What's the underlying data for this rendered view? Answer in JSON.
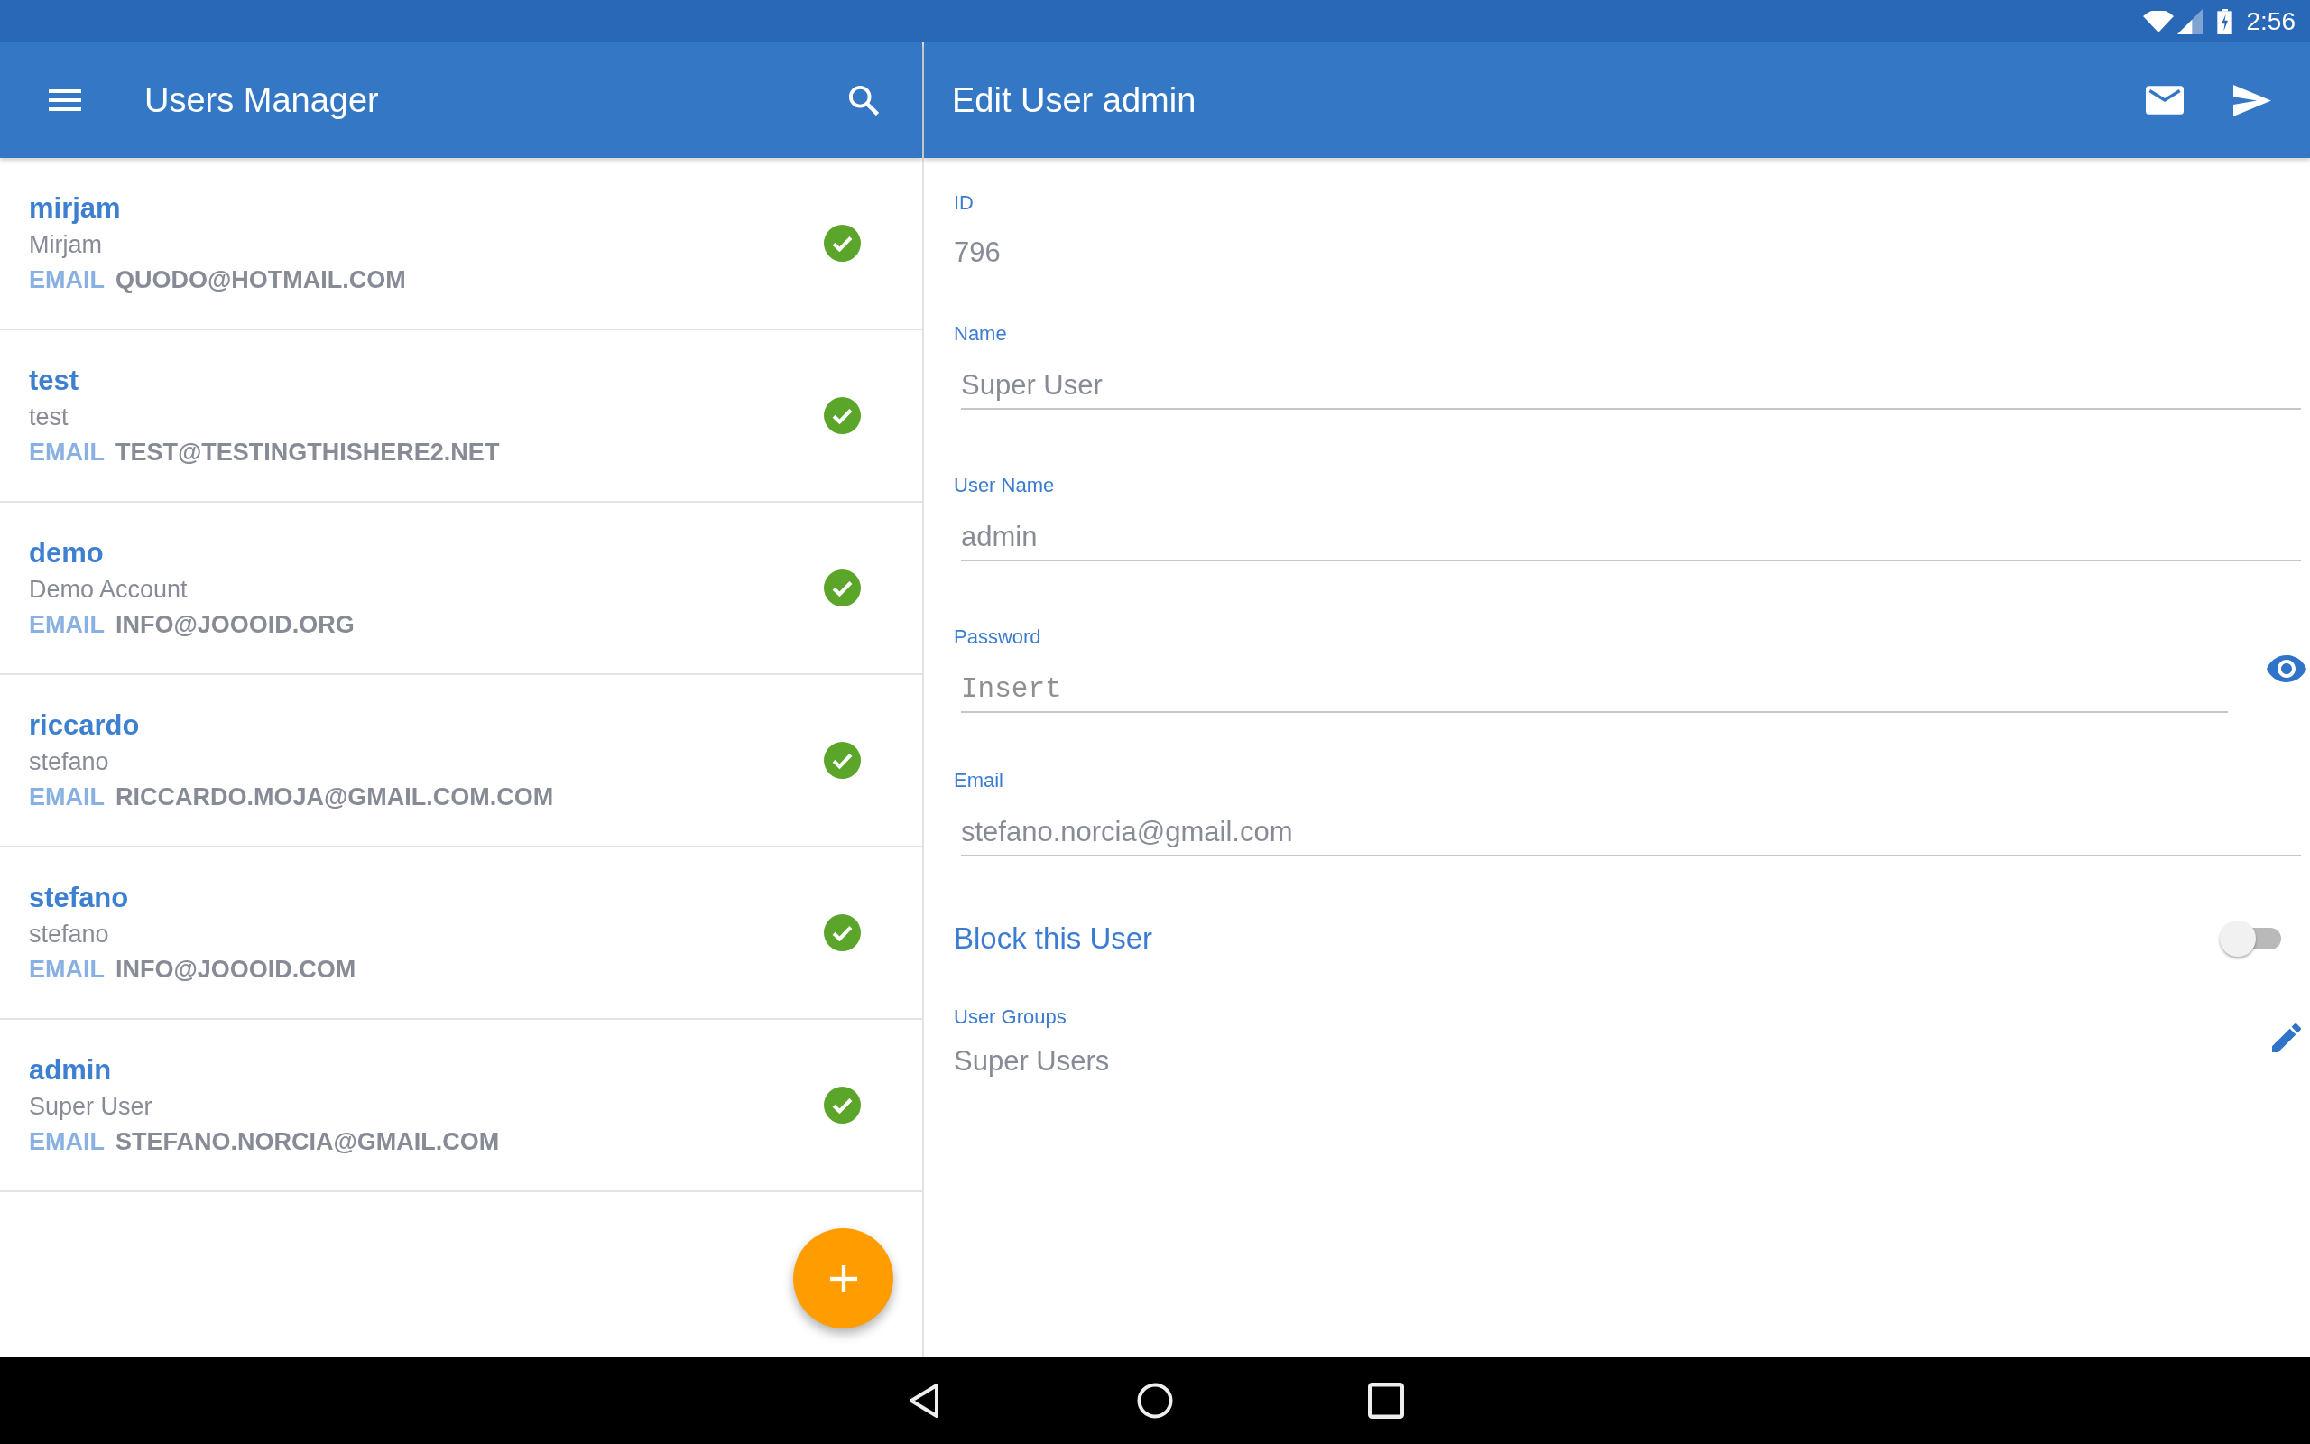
{
  "status_bar": {
    "time": "2:56"
  },
  "list_pane": {
    "title": "Users Manager",
    "users": [
      {
        "username": "mirjam",
        "name": "Mirjam",
        "email_label": "EMAIL",
        "email": "QUODO@HOTMAIL.COM",
        "active": true
      },
      {
        "username": "test",
        "name": "test",
        "email_label": "EMAIL",
        "email": "TEST@TESTINGTHISHERE2.NET",
        "active": true
      },
      {
        "username": "demo",
        "name": "Demo Account",
        "email_label": "EMAIL",
        "email": "INFO@JOOOID.ORG",
        "active": true
      },
      {
        "username": "riccardo",
        "name": "stefano",
        "email_label": "EMAIL",
        "email": "RICCARDO.MOJA@GMAIL.COM.COM",
        "active": true
      },
      {
        "username": "stefano",
        "name": "stefano",
        "email_label": "EMAIL",
        "email": "INFO@JOOOID.COM",
        "active": true
      },
      {
        "username": "admin",
        "name": "Super User",
        "email_label": "EMAIL",
        "email": "STEFANO.NORCIA@GMAIL.COM",
        "active": true
      }
    ]
  },
  "detail_pane": {
    "title": "Edit User admin",
    "fields": [
      {
        "kind": "readonly",
        "label": "ID",
        "value": "796"
      },
      {
        "kind": "text",
        "label": "Name",
        "value": "Super User"
      },
      {
        "kind": "text",
        "label": "User Name",
        "value": "admin"
      },
      {
        "kind": "password",
        "label": "Password",
        "placeholder": "Insert"
      },
      {
        "kind": "text",
        "label": "Email",
        "value": "stefano.norcia@gmail.com"
      },
      {
        "kind": "toggle",
        "label": "Block this User",
        "on": false
      },
      {
        "kind": "groups",
        "label": "User Groups",
        "value": "Super Users"
      }
    ]
  }
}
